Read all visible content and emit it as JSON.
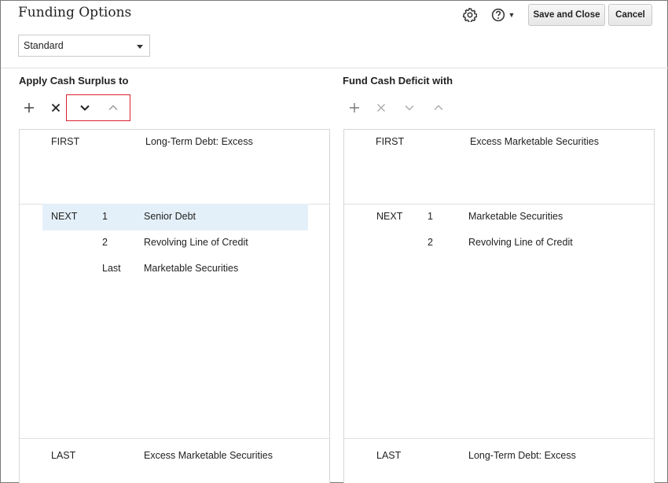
{
  "header": {
    "title": "Funding Options",
    "save_label": "Save and Close",
    "cancel_label": "Cancel"
  },
  "scenario": {
    "selected": "Standard"
  },
  "left": {
    "title": "Apply Cash Surplus to",
    "first": {
      "label": "FIRST",
      "item": "Long-Term Debt: Excess"
    },
    "next": {
      "label": "NEXT",
      "rows": [
        {
          "order": "1",
          "item": "Senior Debt",
          "selected": true
        },
        {
          "order": "2",
          "item": "Revolving Line of Credit"
        },
        {
          "order": "Last",
          "item": "Marketable Securities"
        }
      ]
    },
    "last": {
      "label": "LAST",
      "item": "Excess Marketable Securities"
    }
  },
  "right": {
    "title": "Fund Cash Deficit with",
    "first": {
      "label": "FIRST",
      "item": "Excess Marketable Securities"
    },
    "next": {
      "label": "NEXT",
      "rows": [
        {
          "order": "1",
          "item": "Marketable Securities"
        },
        {
          "order": "2",
          "item": "Revolving Line of Credit"
        }
      ]
    },
    "last": {
      "label": "LAST",
      "item": "Long-Term Debt: Excess"
    }
  },
  "colors": {
    "selected_row": "#e4f0f9",
    "highlight": "#d9232e",
    "disabled_icon": "#aaaaaa"
  }
}
